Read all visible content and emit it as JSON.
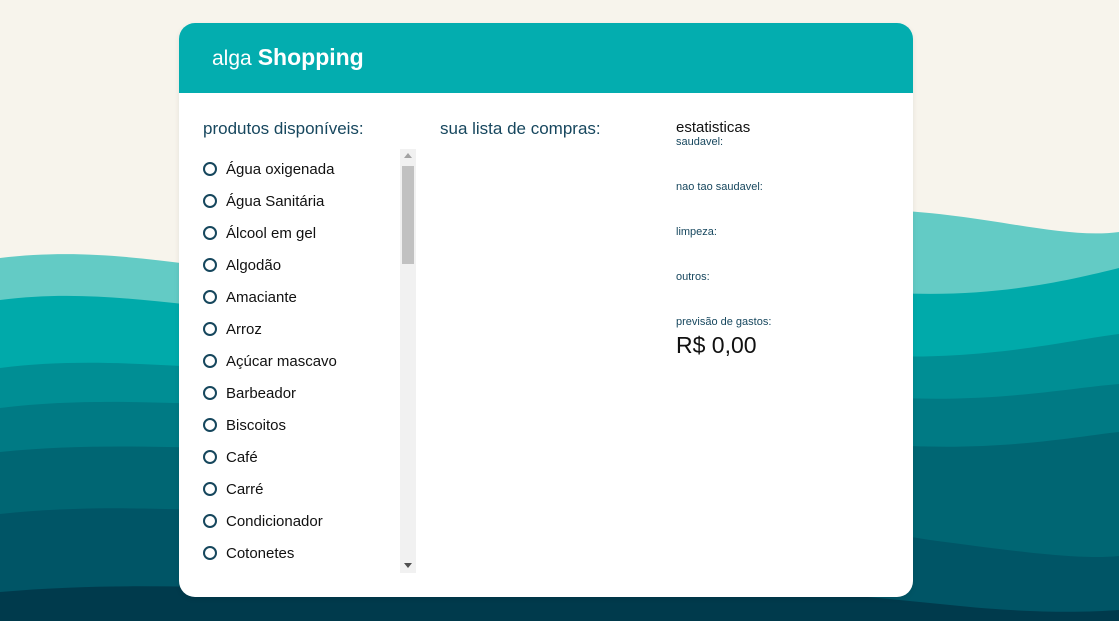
{
  "theme": {
    "accent": "#03adaf",
    "text_dark": "#17475e",
    "background": "#f7f4ec"
  },
  "brand": {
    "light": "alga",
    "bold": "Shopping"
  },
  "products": {
    "title": "produtos disponíveis:",
    "items": [
      "Água oxigenada",
      "Água Sanitária",
      "Álcool em gel",
      "Algodão",
      "Amaciante",
      "Arroz",
      "Açúcar mascavo",
      "Barbeador",
      "Biscoitos",
      "Café",
      "Carré",
      "Condicionador",
      "Cotonetes"
    ]
  },
  "shopping_list": {
    "title": "sua lista de compras:"
  },
  "stats": {
    "title": "estatisticas",
    "healthy_label": "saudavel:",
    "not_healthy_label": "nao tao saudavel:",
    "cleaning_label": "limpeza:",
    "others_label": "outros:",
    "forecast_label": "previsão de gastos:",
    "forecast_value": "R$ 0,00"
  },
  "icons": {
    "radio": "radio-unchecked-icon",
    "scroll_up": "scroll-up-arrow-icon",
    "scroll_down": "scroll-down-arrow-icon"
  }
}
